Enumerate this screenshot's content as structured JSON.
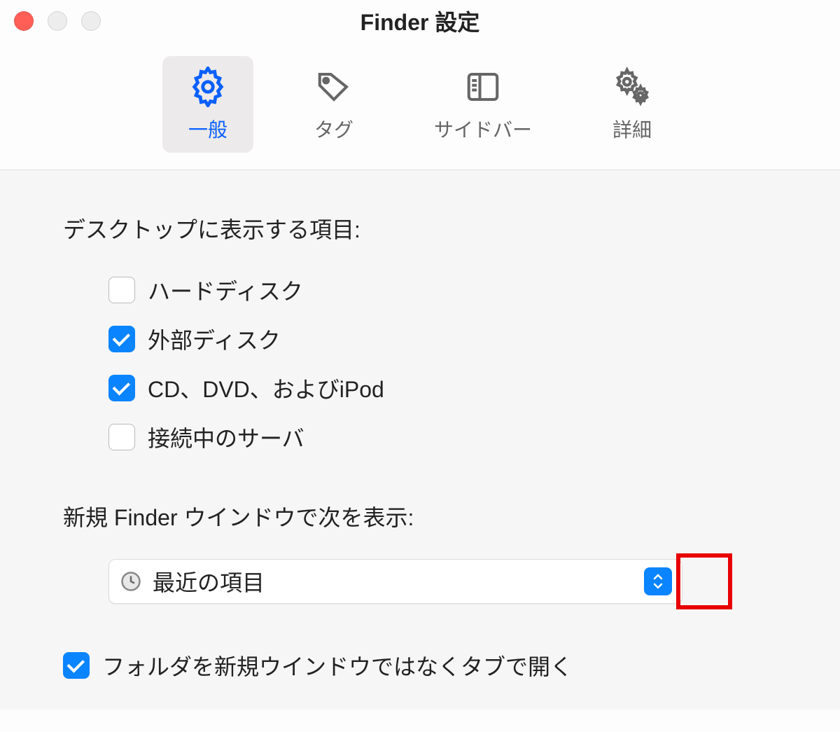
{
  "window": {
    "title": "Finder 設定"
  },
  "tabs": [
    {
      "label": "一般",
      "active": true
    },
    {
      "label": "タグ",
      "active": false
    },
    {
      "label": "サイドバー",
      "active": false
    },
    {
      "label": "詳細",
      "active": false
    }
  ],
  "desktop_section": {
    "label": "デスクトップに表示する項目:",
    "items": [
      {
        "label": "ハードディスク",
        "checked": false
      },
      {
        "label": "外部ディスク",
        "checked": true
      },
      {
        "label": "CD、DVD、およびiPod",
        "checked": true
      },
      {
        "label": "接続中のサーバ",
        "checked": false
      }
    ]
  },
  "new_window_section": {
    "label": "新規 Finder ウインドウで次を表示:",
    "selected": "最近の項目"
  },
  "open_in_tabs": {
    "label": "フォルダを新規ウインドウではなくタブで開く",
    "checked": true
  }
}
